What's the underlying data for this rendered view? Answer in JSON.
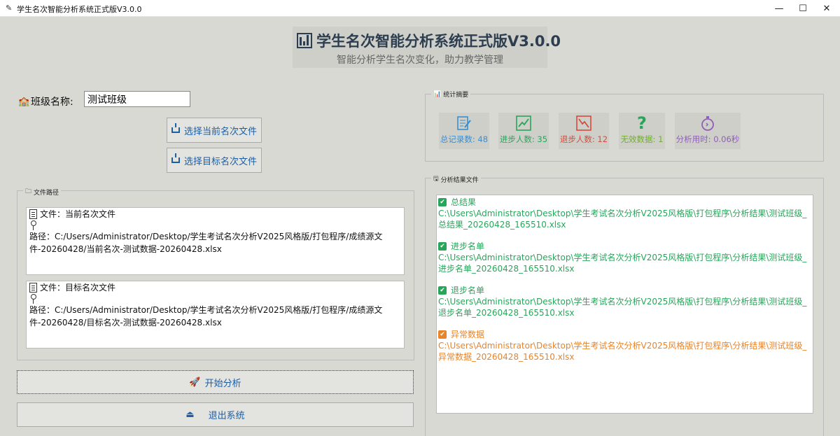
{
  "window": {
    "title": "学生名次智能分析系统正式版V3.0.0",
    "controls": {
      "minimize": "—",
      "maximize": "☐",
      "close": "✕"
    }
  },
  "header": {
    "title": "学生名次智能分析系统正式版V3.0.0",
    "subtitle": "智能分析学生名次变化，助力教学管理",
    "icon": "bar-chart-icon"
  },
  "class": {
    "label": "班级名称:",
    "value": "测试班级"
  },
  "buttons": {
    "select_current": "选择当前名次文件",
    "select_target": "选择目标名次文件",
    "start": "开始分析",
    "exit": "退出系统"
  },
  "file_paths": {
    "legend": "文件路径",
    "current": {
      "name": "文件：当前名次文件",
      "path": "路径：C:/Users/Administrator/Desktop/学生考试名次分析V2025风格版/打包程序/成绩源文件-20260428/当前名次-测试数据-20260428.xlsx"
    },
    "target": {
      "name": "文件：目标名次文件",
      "path": "路径：C:/Users/Administrator/Desktop/学生考试名次分析V2025风格版/打包程序/成绩源文件-20260428/目标名次-测试数据-20260428.xlsx"
    }
  },
  "stats": {
    "legend": "统计摘要",
    "total": "总记录数: 48",
    "improved": "进步人数: 35",
    "declined": "退步人数: 12",
    "invalid": "无效数据: 1",
    "time": "分析用时: 0.06秒",
    "colors": {
      "total": "#3a8fd0",
      "improved": "#27a65a",
      "declined": "#d94a3a",
      "invalid": "#6fae2b",
      "time": "#8e5fb8"
    }
  },
  "results": {
    "legend": "分析结果文件",
    "items": [
      {
        "name": "总结果",
        "path": "C:\\Users\\Administrator\\Desktop\\学生考试名次分析V2025风格版\\打包程序\\分析结果\\测试班级_总结果_20260428_165510.xlsx"
      },
      {
        "name": "进步名单",
        "path": "C:\\Users\\Administrator\\Desktop\\学生考试名次分析V2025风格版\\打包程序\\分析结果\\测试班级_进步名单_20260428_165510.xlsx"
      },
      {
        "name": "退步名单",
        "path": "C:\\Users\\Administrator\\Desktop\\学生考试名次分析V2025风格版\\打包程序\\分析结果\\测试班级_退步名单_20260428_165510.xlsx"
      },
      {
        "name": "异常数据",
        "path": "C:\\Users\\Administrator\\Desktop\\学生考试名次分析V2025风格版\\打包程序\\分析结果\\测试班级_异常数据_20260428_165510.xlsx"
      }
    ],
    "colors": {
      "ok": "#27a65a",
      "warn": "#e8842a"
    }
  }
}
